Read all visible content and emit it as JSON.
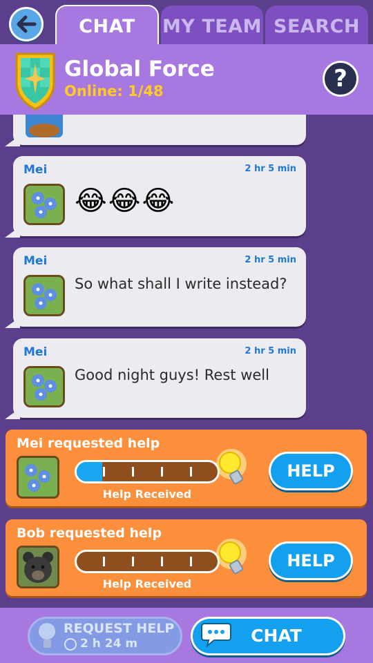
{
  "tabs": [
    {
      "label": "CHAT",
      "active": true
    },
    {
      "label": "MY TEAM",
      "active": false
    },
    {
      "label": "SEARCH",
      "active": false
    }
  ],
  "team": {
    "name": "Global Force",
    "online": "Online: 1/48"
  },
  "messages": [
    {
      "sender": "Mei",
      "time": "2 hr 5 min",
      "type": "emoji",
      "text": "😂😂😂"
    },
    {
      "sender": "Mei",
      "time": "2 hr 5 min",
      "type": "text",
      "text": "So what shall I write instead?"
    },
    {
      "sender": "Mei",
      "time": "2 hr 5 min",
      "type": "text",
      "text": "Good night guys! Rest well"
    }
  ],
  "help_requests": [
    {
      "title": "Mei requested help",
      "progress_fraction": 0.18,
      "label": "Help Received",
      "button": "HELP",
      "avatar": "flower-avatar"
    },
    {
      "title": "Bob requested help",
      "progress_fraction": 0.0,
      "label": "Help Received",
      "button": "HELP",
      "avatar": "bear-avatar"
    }
  ],
  "bottom": {
    "request_help_label": "REQUEST HELP",
    "request_help_timer": "2 h 24 m",
    "chat_label": "CHAT"
  },
  "colors": {
    "background": "#5b3f8c",
    "header": "#a678e0",
    "accent_blue": "#13a0ef",
    "help_card": "#fb8f3b",
    "online_text": "#ffcb22"
  }
}
